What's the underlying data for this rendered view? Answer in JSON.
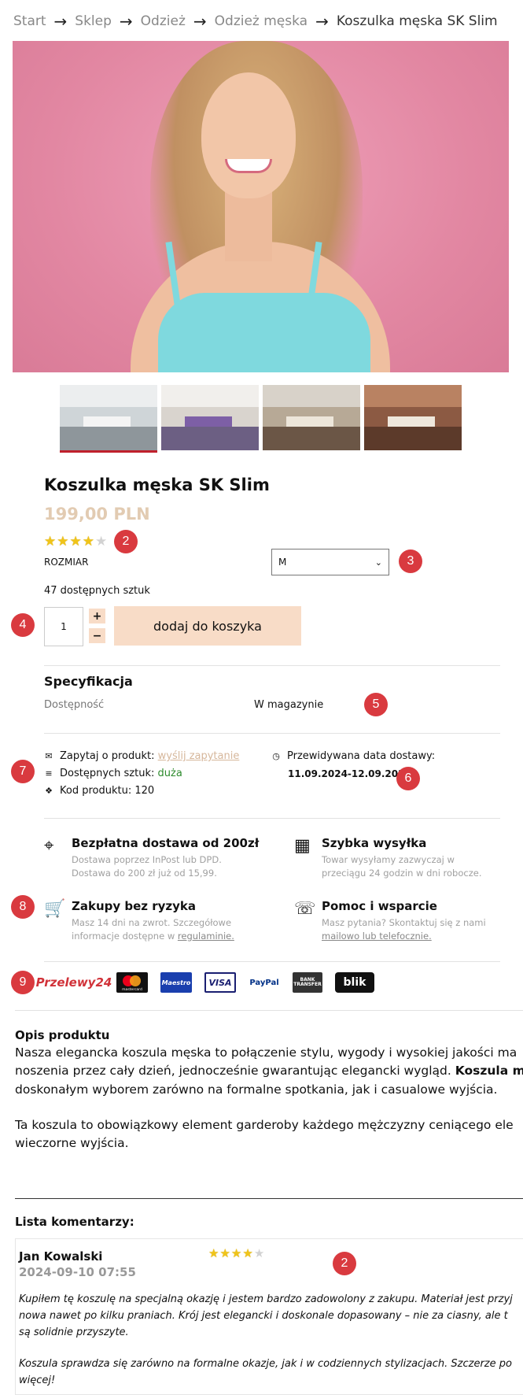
{
  "breadcrumb": {
    "items": [
      "Start",
      "Sklep",
      "Odzież",
      "Odzież męska"
    ],
    "current": "Koszulka męska SK Slim",
    "separator": "→"
  },
  "product": {
    "title": "Koszulka męska SK Slim",
    "price": "199,00 PLN",
    "rating": 4,
    "rating_max": 5,
    "size_label": "ROZMIAR",
    "size_value": "M",
    "stock_text": "47 dostępnych sztuk",
    "quantity": "1",
    "qty_plus": "+",
    "qty_minus": "−",
    "add_to_cart": "dodaj do koszyka"
  },
  "spec": {
    "title": "Specyfikacja",
    "key": "Dostępność",
    "value": "W magazynie"
  },
  "info": {
    "ask_label": "Zapytaj o produkt:",
    "ask_link": "wyślij zapytanie",
    "available_label": "Dostępnych sztuk:",
    "available_value": "duża",
    "code": "Kod produktu: 120",
    "delivery_label": "Przewidywana data dostawy:",
    "delivery_date": "11.09.2024-12.09.2024"
  },
  "features": [
    {
      "title": "Bezpłatna dostawa od 200zł",
      "desc": "Dostawa poprzez InPost lub DPD. Dostawa do 200 zł już od 15,99."
    },
    {
      "title": "Szybka wysyłka",
      "desc": "Towar wysyłamy zazwyczaj w przeciągu 24 godzin w dni robocze."
    },
    {
      "title": "Zakupy bez ryzyka",
      "desc": "Masz 14 dni na zwrot. Szczegółowe informacje dostępne w",
      "link": "regulaminie."
    },
    {
      "title": "Pomoc i wsparcie",
      "desc": "Masz pytania? Skontaktuj się z nami",
      "link": "mailowo lub telefocznie."
    }
  ],
  "payments": {
    "przelewy": "Przelewy24",
    "mastercard": "mastercard",
    "maestro": "Maestro",
    "visa": "VISA",
    "paypal": "PayPal",
    "bank": "BANK TRANSFER",
    "blik": "blik"
  },
  "description": {
    "title": "Opis produktu",
    "p1_line1": "Nasza elegancka koszula męska to połączenie stylu, wygody i wysokiej jakości ma",
    "p1_line2a": "noszenia przez cały dzień, jednocześnie gwarantując elegancki wygląd. ",
    "p1_line2b": "Koszula m",
    "p1_line3": "doskonałym wyborem zarówno na formalne spotkania, jak i casualowe wyjścia.",
    "p2_line1": "Ta koszula to obowiązkowy element garderoby każdego mężczyzny ceniącego ele",
    "p2_line2": "wieczorne wyjścia."
  },
  "comments": {
    "title": "Lista komentarzy:",
    "author": "Jan Kowalski",
    "date": "2024-09-10 07:55",
    "rating": 4,
    "line1": "Kupiłem tę koszulę na specjalną okazję i jestem bardzo zadowolony z zakupu. Materiał jest przyj",
    "line2": "nowa nawet po kilku praniach. Krój jest elegancki i doskonale dopasowany – nie za ciasny, ale t",
    "line3": "są solidnie przyszyte.",
    "line4": "Koszula sprawdza się zarówno na formalne okazje, jak i w codziennych stylizacjach. Szczerze po",
    "line5": "więcej!"
  },
  "badges": {
    "rating": "2",
    "size": "3",
    "quantity": "4",
    "availability": "5",
    "delivery": "6",
    "info": "7",
    "features": "8",
    "payments": "9",
    "comment_rating": "2"
  },
  "colors": {
    "accent_red": "#d93a3f",
    "price": "#e2cbb2",
    "button_bg": "#f8dcc7",
    "star": "#f0c419"
  }
}
